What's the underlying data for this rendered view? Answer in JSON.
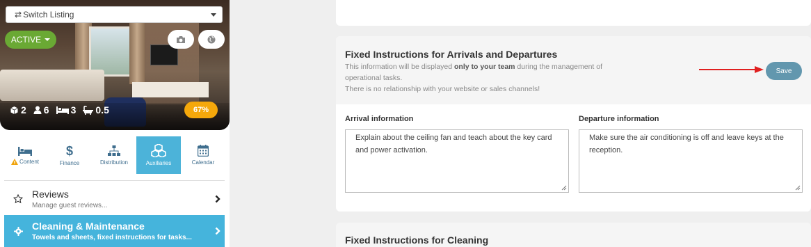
{
  "listing": {
    "switch_label": "Switch Listing",
    "status_label": "ACTIVE",
    "stats": {
      "units": "2",
      "guests": "6",
      "beds": "3",
      "baths": "0.5"
    },
    "completion": "67%"
  },
  "tabs": [
    {
      "label": "Content",
      "icon": "bed-icon",
      "warning": true
    },
    {
      "label": "Finance",
      "icon": "dollar-icon"
    },
    {
      "label": "Distribution",
      "icon": "sitemap-icon"
    },
    {
      "label": "Auxiliaries",
      "icon": "cubes-icon",
      "active": true
    },
    {
      "label": "Calendar",
      "icon": "calendar-icon"
    }
  ],
  "menu": {
    "reviews": {
      "title": "Reviews",
      "subtitle": "Manage guest reviews..."
    },
    "cleaning": {
      "title": "Cleaning & Maintenance",
      "subtitle": "Towels and sheets, fixed instructions for tasks..."
    }
  },
  "arrivals_card": {
    "title": "Fixed Instructions for Arrivals and Departures",
    "desc_pre": "This information will be displayed ",
    "desc_bold": "only to your team",
    "desc_post": " during the management of operational tasks.",
    "desc_line2": "There is no relationship with your website or sales channels!",
    "save_label": "Save",
    "arrival_label": "Arrival information",
    "arrival_value": "Explain about the ceiling fan and teach about the key card and power activation.",
    "departure_label": "Departure information",
    "departure_value": "Make sure the air conditioning is off and leave keys at the reception."
  },
  "cleaning_card": {
    "title": "Fixed Instructions for Cleaning"
  },
  "colors": {
    "accent": "#45b4dc",
    "active_green": "#6aa934",
    "badge_orange": "#f5a80b",
    "save_blue": "#6297ae",
    "arrow_red": "#e02020"
  }
}
